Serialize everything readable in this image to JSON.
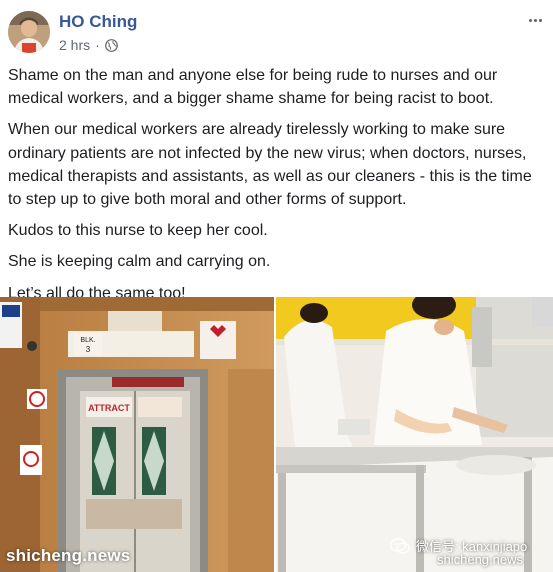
{
  "post": {
    "author": "HO Ching",
    "time": "2 hrs",
    "separator": "·",
    "paragraphs": [
      "Shame on the man and anyone else for being rude to nurses and our medical workers, and a bigger shame shame for being racist to boot.",
      "When our medical workers are already tirelessly working to make sure ordinary patients are not infected by the new virus; when doctors, nurses, medical therapists and assistants, as well as our cleaners - this is the time to step up to give both moral and other forms of support.",
      "Kudos to this nurse to keep her cool.",
      "She is keeping calm and carrying on.",
      "Let’s all do the same too!"
    ]
  },
  "images": {
    "left_signs": {
      "blk": "BLK.",
      "blk_num": "3",
      "attract": "ATTRACT"
    }
  },
  "watermarks": {
    "left": "shicheng.news",
    "wechat": "微信号: kanxinjiapo",
    "right": "shicheng.news"
  },
  "icons": {
    "privacy": "globe-icon",
    "menu": "more-horizontal-icon",
    "wechat": "wechat-icon"
  },
  "colors": {
    "author": "#385898",
    "text": "#1c1e21",
    "meta": "#606770"
  }
}
